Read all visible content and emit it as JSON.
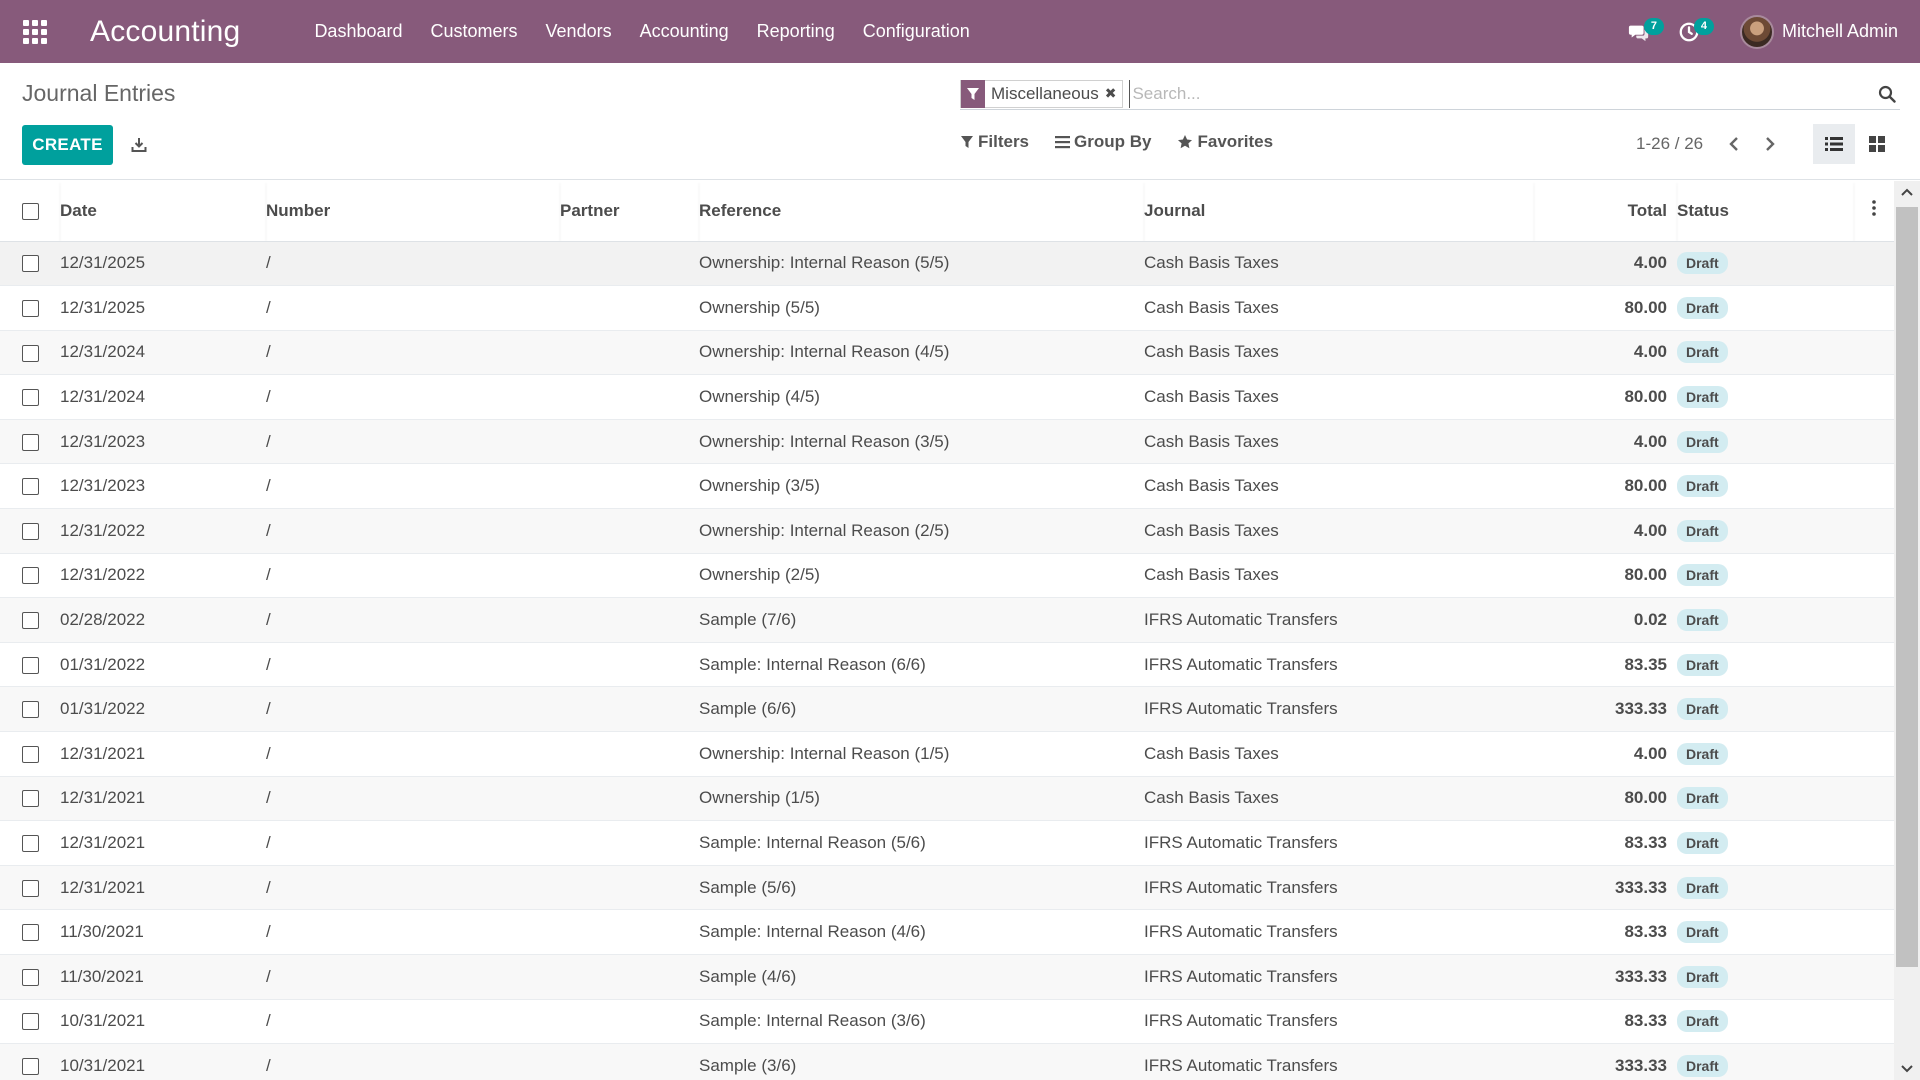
{
  "navbar": {
    "brand": "Accounting",
    "menu": [
      "Dashboard",
      "Customers",
      "Vendors",
      "Accounting",
      "Reporting",
      "Configuration"
    ],
    "messages_badge": "7",
    "activities_badge": "4",
    "user_name": "Mitchell Admin",
    "color": "#875a7b"
  },
  "control": {
    "title": "Journal Entries",
    "create_label": "CREATE",
    "facet_label": "Miscellaneous",
    "search_placeholder": "Search...",
    "filters_label": "Filters",
    "groupby_label": "Group By",
    "favorites_label": "Favorites",
    "pager": "1-26 / 26",
    "accent": "#00a09d"
  },
  "table": {
    "headers": {
      "date": "Date",
      "number": "Number",
      "partner": "Partner",
      "reference": "Reference",
      "journal": "Journal",
      "total": "Total",
      "status": "Status"
    },
    "rows": [
      {
        "date": "12/31/2025",
        "number": "/",
        "partner": "",
        "reference": "Ownership: Internal Reason (5/5)",
        "journal": "Cash Basis Taxes",
        "total": "4.00",
        "status": "Draft"
      },
      {
        "date": "12/31/2025",
        "number": "/",
        "partner": "",
        "reference": "Ownership (5/5)",
        "journal": "Cash Basis Taxes",
        "total": "80.00",
        "status": "Draft"
      },
      {
        "date": "12/31/2024",
        "number": "/",
        "partner": "",
        "reference": "Ownership: Internal Reason (4/5)",
        "journal": "Cash Basis Taxes",
        "total": "4.00",
        "status": "Draft"
      },
      {
        "date": "12/31/2024",
        "number": "/",
        "partner": "",
        "reference": "Ownership (4/5)",
        "journal": "Cash Basis Taxes",
        "total": "80.00",
        "status": "Draft"
      },
      {
        "date": "12/31/2023",
        "number": "/",
        "partner": "",
        "reference": "Ownership: Internal Reason (3/5)",
        "journal": "Cash Basis Taxes",
        "total": "4.00",
        "status": "Draft"
      },
      {
        "date": "12/31/2023",
        "number": "/",
        "partner": "",
        "reference": "Ownership (3/5)",
        "journal": "Cash Basis Taxes",
        "total": "80.00",
        "status": "Draft"
      },
      {
        "date": "12/31/2022",
        "number": "/",
        "partner": "",
        "reference": "Ownership: Internal Reason (2/5)",
        "journal": "Cash Basis Taxes",
        "total": "4.00",
        "status": "Draft"
      },
      {
        "date": "12/31/2022",
        "number": "/",
        "partner": "",
        "reference": "Ownership (2/5)",
        "journal": "Cash Basis Taxes",
        "total": "80.00",
        "status": "Draft"
      },
      {
        "date": "02/28/2022",
        "number": "/",
        "partner": "",
        "reference": "Sample (7/6)",
        "journal": "IFRS Automatic Transfers",
        "total": "0.02",
        "status": "Draft"
      },
      {
        "date": "01/31/2022",
        "number": "/",
        "partner": "",
        "reference": "Sample: Internal Reason (6/6)",
        "journal": "IFRS Automatic Transfers",
        "total": "83.35",
        "status": "Draft"
      },
      {
        "date": "01/31/2022",
        "number": "/",
        "partner": "",
        "reference": "Sample (6/6)",
        "journal": "IFRS Automatic Transfers",
        "total": "333.33",
        "status": "Draft"
      },
      {
        "date": "12/31/2021",
        "number": "/",
        "partner": "",
        "reference": "Ownership: Internal Reason (1/5)",
        "journal": "Cash Basis Taxes",
        "total": "4.00",
        "status": "Draft"
      },
      {
        "date": "12/31/2021",
        "number": "/",
        "partner": "",
        "reference": "Ownership (1/5)",
        "journal": "Cash Basis Taxes",
        "total": "80.00",
        "status": "Draft"
      },
      {
        "date": "12/31/2021",
        "number": "/",
        "partner": "",
        "reference": "Sample: Internal Reason (5/6)",
        "journal": "IFRS Automatic Transfers",
        "total": "83.33",
        "status": "Draft"
      },
      {
        "date": "12/31/2021",
        "number": "/",
        "partner": "",
        "reference": "Sample (5/6)",
        "journal": "IFRS Automatic Transfers",
        "total": "333.33",
        "status": "Draft"
      },
      {
        "date": "11/30/2021",
        "number": "/",
        "partner": "",
        "reference": "Sample: Internal Reason (4/6)",
        "journal": "IFRS Automatic Transfers",
        "total": "83.33",
        "status": "Draft"
      },
      {
        "date": "11/30/2021",
        "number": "/",
        "partner": "",
        "reference": "Sample (4/6)",
        "journal": "IFRS Automatic Transfers",
        "total": "333.33",
        "status": "Draft"
      },
      {
        "date": "10/31/2021",
        "number": "/",
        "partner": "",
        "reference": "Sample: Internal Reason (3/6)",
        "journal": "IFRS Automatic Transfers",
        "total": "83.33",
        "status": "Draft"
      },
      {
        "date": "10/31/2021",
        "number": "/",
        "partner": "",
        "reference": "Sample (3/6)",
        "journal": "IFRS Automatic Transfers",
        "total": "333.33",
        "status": "Draft"
      }
    ],
    "status_badge_color": "#d3ecf1"
  }
}
